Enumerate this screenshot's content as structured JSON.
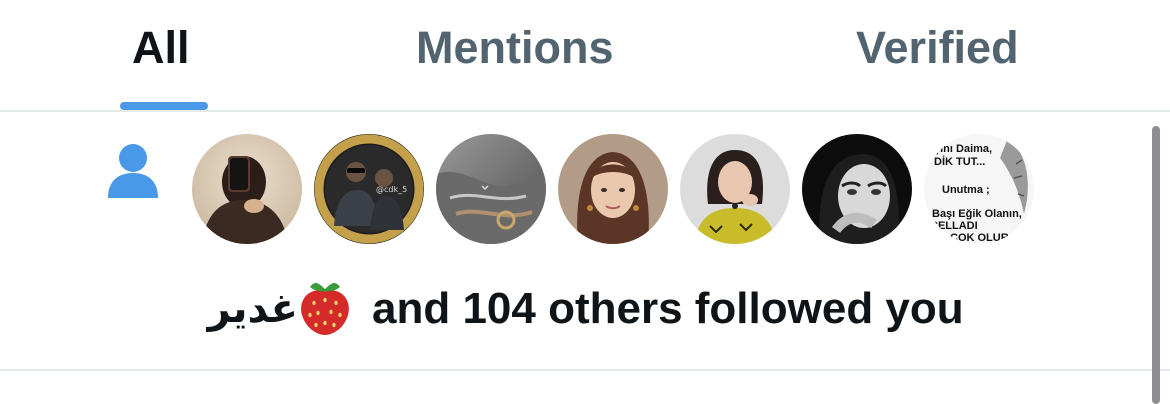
{
  "tabs": [
    {
      "label": "All",
      "active": true
    },
    {
      "label": "Mentions",
      "active": false
    },
    {
      "label": "Verified",
      "active": false
    }
  ],
  "accent_color": "#4a99e9",
  "notification": {
    "type_icon": "person-icon",
    "actor_name": "غدير",
    "actor_emoji": "strawberry-emoji",
    "message": "and 104 others followed you",
    "avatars": [
      {
        "name": "avatar-1"
      },
      {
        "name": "avatar-2",
        "overlay_text": "@cdk_5"
      },
      {
        "name": "avatar-3"
      },
      {
        "name": "avatar-4"
      },
      {
        "name": "avatar-5"
      },
      {
        "name": "avatar-6"
      },
      {
        "name": "avatar-7",
        "text_lines": [
          "şını Daima,",
          "DİK TUT...",
          "Unutma ;",
          "Başı Eğik Olanın,",
          "CELLADI",
          "ÇOK OLUR..."
        ]
      }
    ]
  }
}
